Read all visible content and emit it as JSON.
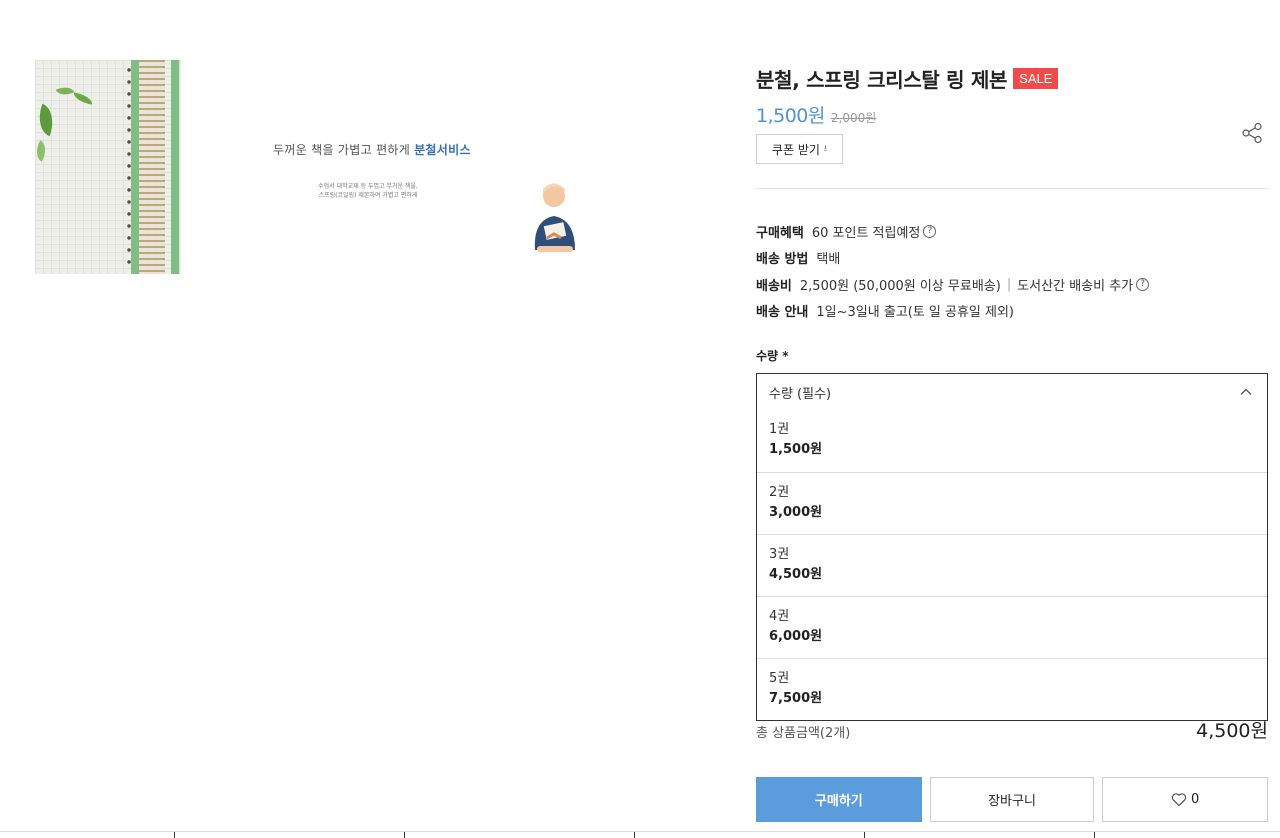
{
  "product": {
    "title": "분철, 스프링 크리스탈 링 제본",
    "sale_badge": "SALE",
    "price": "1,500원",
    "original_price": "2,000원",
    "coupon_button": "쿠폰 받기",
    "share_icon": "share-icon"
  },
  "banner": {
    "headline": "두꺼운 책을 가볍고 편하게",
    "headline_highlight": "분철서비스",
    "sub_line1": "수험서 대학교재 등 두껍고 무거운 책을,",
    "sub_line2": "스프링(코일링) 제본하여 가볍고 편하게"
  },
  "info": {
    "benefit_label": "구매혜택",
    "benefit_value": "60 포인트 적립예정",
    "shipping_method_label": "배송 방법",
    "shipping_method_value": "택배",
    "shipping_fee_label": "배송비",
    "shipping_fee_value": "2,500원 (50,000원 이상 무료배송)",
    "shipping_fee_sep": "|",
    "shipping_fee_extra": "도서산간 배송비 추가",
    "shipping_guide_label": "배송 안내",
    "shipping_guide_value": "1일~3일내 출고(토 일 공휴일 제외)"
  },
  "quantity": {
    "label": "수량 *",
    "placeholder": "수량 (필수)",
    "options": [
      {
        "name": "1권",
        "price": "1,500원"
      },
      {
        "name": "2권",
        "price": "3,000원"
      },
      {
        "name": "3권",
        "price": "4,500원"
      },
      {
        "name": "4권",
        "price": "6,000원"
      },
      {
        "name": "5권",
        "price": "7,500원"
      }
    ]
  },
  "total": {
    "label": "총 상품금액(2개)",
    "amount": "4,500원"
  },
  "actions": {
    "buy": "구매하기",
    "cart": "장바구니",
    "like_count": "0"
  },
  "colors": {
    "accent": "#4f93d6",
    "buy_button": "#5b9ddc",
    "sale_badge": "#f04b4b"
  }
}
